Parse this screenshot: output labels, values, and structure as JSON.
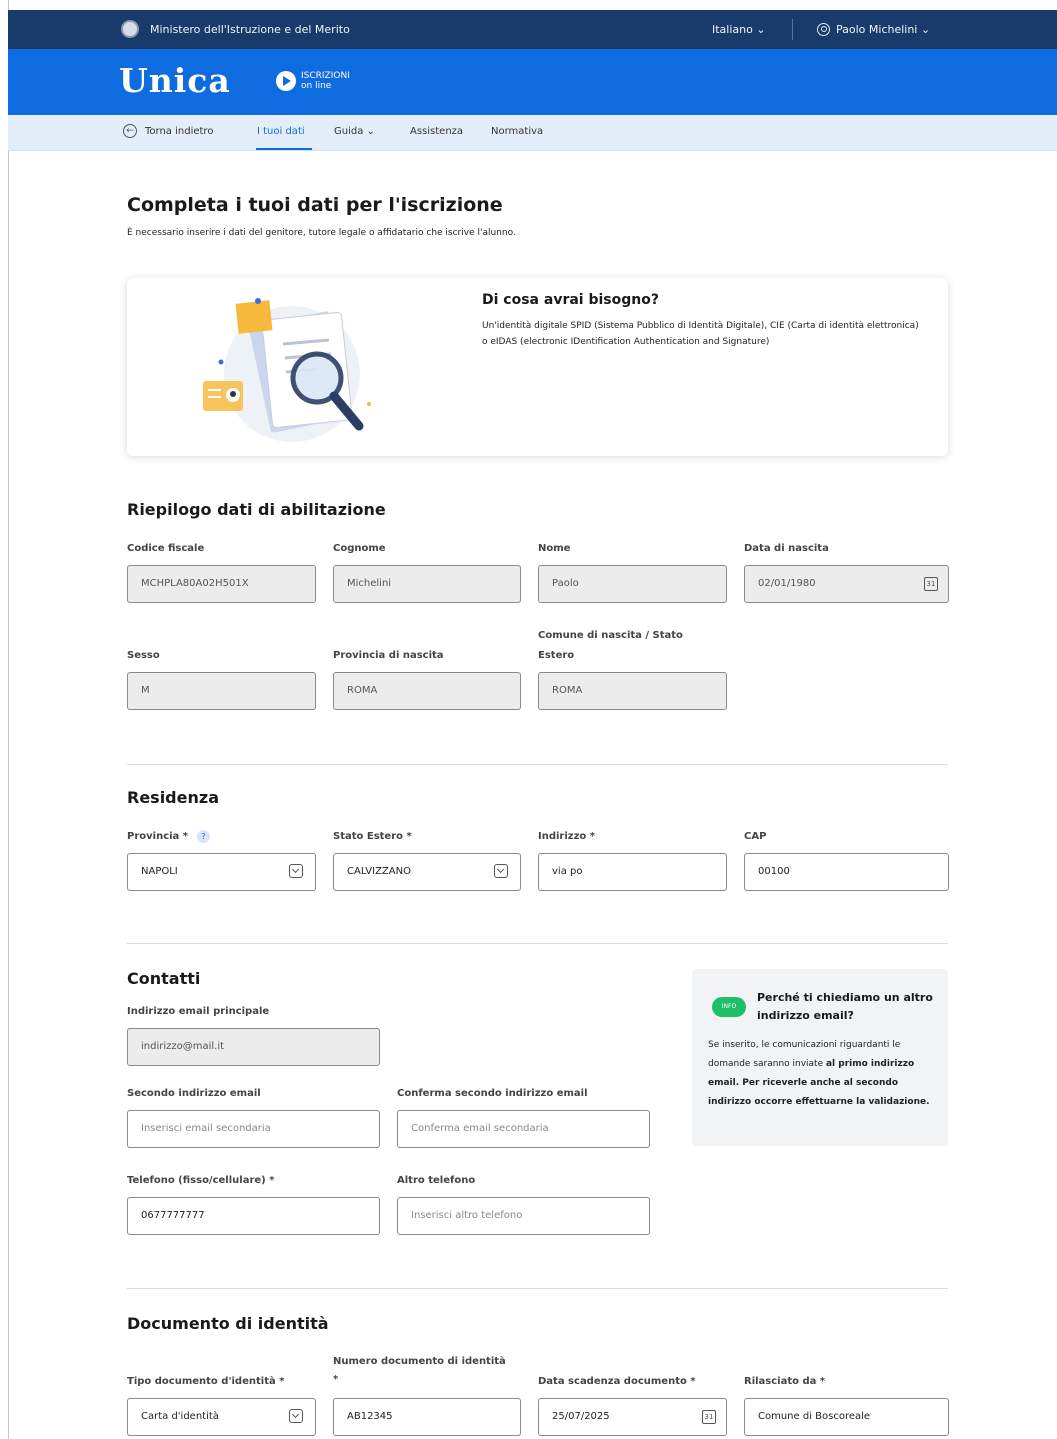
{
  "topbar": {
    "ministry": "Ministero dell'Istruzione e del Merito",
    "language": "Italiano ⌄",
    "user": "Paolo Michelini ⌄"
  },
  "brand": {
    "logo": "Unica",
    "sub_line1": "ISCRIZIONI",
    "sub_line2": "on line"
  },
  "nav": {
    "back": "Torna indietro",
    "items": [
      "I tuoi dati",
      "Guida ⌄",
      "Assistenza",
      "Normativa"
    ]
  },
  "page": {
    "title": "Completa i tuoi dati per l'iscrizione",
    "lead": "È necessario inserire i dati del genitore, tutore legale o affidatario che iscrive l'alunno."
  },
  "card": {
    "title": "Di cosa avrai bisogno?",
    "text": "Un'identità digitale SPID (Sistema Pubblico di Identità Digitale), CIE (Carta di identità elettronica) o eIDAS (electronic IDentification Authentication and Signature)"
  },
  "riepilogo": {
    "title": "Riepilogo dati di abilitazione",
    "codice_fiscale_label": "Codice fiscale",
    "codice_fiscale": "MCHPLA80A02H501X",
    "cognome_label": "Cognome",
    "cognome": "Michelini",
    "nome_label": "Nome",
    "nome": "Paolo",
    "data_nascita_label": "Data di nascita",
    "data_nascita": "02/01/1980",
    "sesso_label": "Sesso",
    "sesso": "M",
    "provincia_label": "Provincia di nascita",
    "provincia": "ROMA",
    "comune_label_1": "Comune di nascita / Stato",
    "comune_label_2": "Estero",
    "comune": "ROMA",
    "calendar_glyph": "31"
  },
  "residenza": {
    "title": "Residenza",
    "provincia_label": "Provincia *",
    "help_glyph": "?",
    "provincia": "NAPOLI",
    "stato_label": "Stato Estero *",
    "stato": "CALVIZZANO",
    "indirizzo_label": "Indirizzo *",
    "indirizzo": "via po",
    "cap_label": "CAP",
    "cap": "00100"
  },
  "contatti": {
    "title": "Contatti",
    "email_label": "Indirizzo email principale",
    "email": "indirizzo@mail.it",
    "email2_label": "Secondo indirizzo email",
    "email2_placeholder": "Inserisci email secondaria",
    "conferma_label": "Conferma secondo indirizzo email",
    "conferma_placeholder": "Conferma email secondaria",
    "telefono_label": "Telefono (fisso/cellulare) *",
    "telefono": "0677777777",
    "altro_label": "Altro telefono",
    "altro_placeholder": "Inserisci altro telefono"
  },
  "info": {
    "badge": "INFO",
    "title": "Perché ti chiediamo un altro indirizzo email?",
    "text_1": "Se inserito, le comunicazioni riguardanti le domande saranno inviate ",
    "text_bold_1": "al primo indirizzo email. Per riceverle anche al secondo indirizzo occorre effettuarne la validazione."
  },
  "documento": {
    "title": "Documento di identità",
    "tipo_label": "Tipo documento d'identità *",
    "tipo": "Carta d'identità",
    "numero_label_1": "Numero documento di identità",
    "numero_label_2": "*",
    "numero": "AB12345",
    "scadenza_label": "Data scadenza documento *",
    "scadenza": "25/07/2025",
    "rilasciato_label": "Rilasciato da *",
    "rilasciato": "Comune di Boscoreale"
  }
}
